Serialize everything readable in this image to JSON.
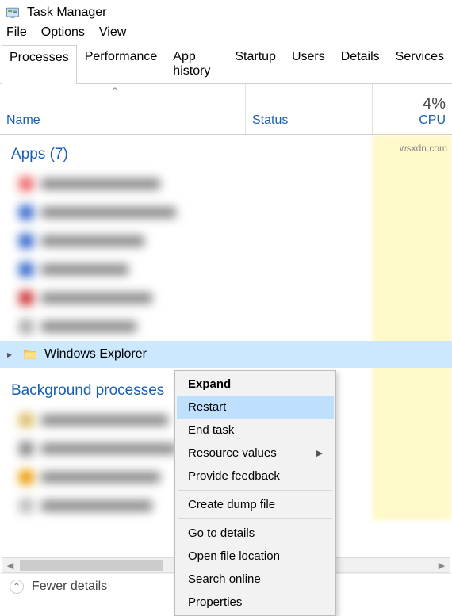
{
  "window": {
    "title": "Task Manager"
  },
  "menubar": {
    "file": "File",
    "options": "Options",
    "view": "View"
  },
  "tabs": {
    "processes": "Processes",
    "performance": "Performance",
    "app_history": "App history",
    "startup": "Startup",
    "users": "Users",
    "details": "Details",
    "services": "Services"
  },
  "columns": {
    "name": "Name",
    "status": "Status",
    "cpu_label": "CPU",
    "cpu_value": "4%"
  },
  "groups": {
    "apps": "Apps (7)",
    "background": "Background processes"
  },
  "selected_row": {
    "name": "Windows Explorer"
  },
  "context_menu": {
    "expand": "Expand",
    "restart": "Restart",
    "end_task": "End task",
    "resource_values": "Resource values",
    "provide_feedback": "Provide feedback",
    "create_dump": "Create dump file",
    "go_to_details": "Go to details",
    "open_file_location": "Open file location",
    "search_online": "Search online",
    "properties": "Properties"
  },
  "footer": {
    "fewer_details": "Fewer details"
  },
  "watermark": "wsxdn.com"
}
